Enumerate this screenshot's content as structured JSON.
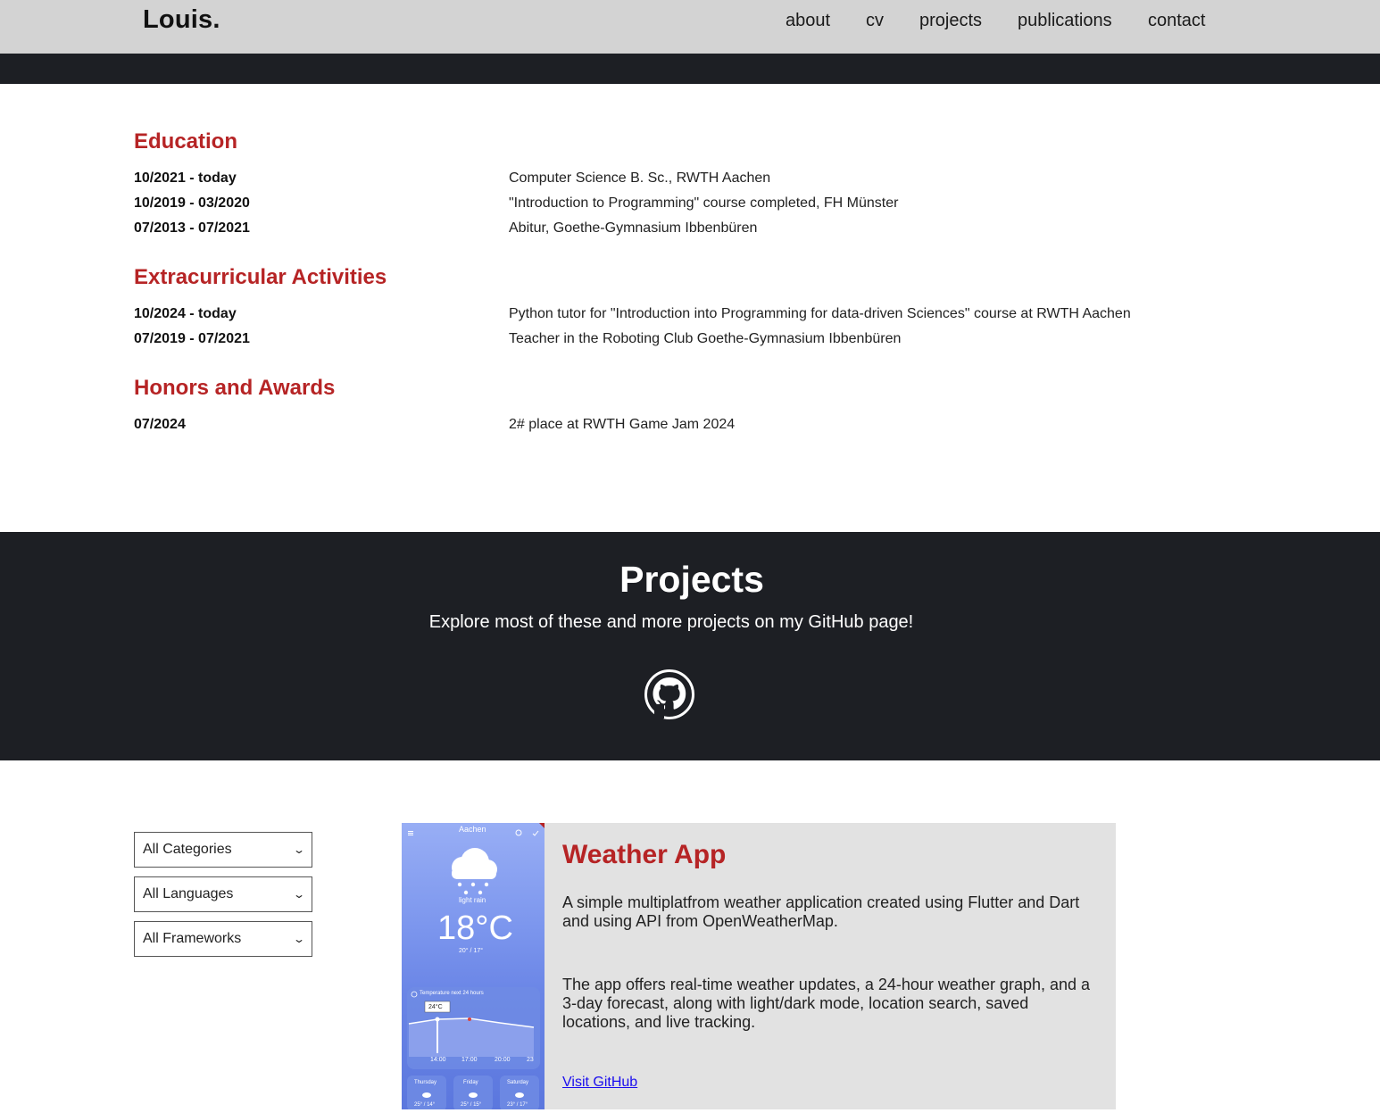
{
  "navbar": {
    "brand": "Louis.",
    "links": [
      "about",
      "cv",
      "projects",
      "publications",
      "contact"
    ]
  },
  "cv": {
    "education": {
      "heading": "Education",
      "entries": [
        {
          "date": "10/2021 - today",
          "text": "Computer Science B. Sc., RWTH Aachen"
        },
        {
          "date": "10/2019 - 03/2020",
          "text": "\"Introduction to Programming\" course completed, FH Münster"
        },
        {
          "date": "07/2013 - 07/2021",
          "text": "Abitur, Goethe-Gymnasium Ibbenbüren"
        }
      ]
    },
    "extracurricular": {
      "heading": "Extracurricular Activities",
      "entries": [
        {
          "date": "10/2024 - today",
          "text": "Python tutor for \"Introduction into Programming for data-driven Sciences\" course at RWTH Aachen"
        },
        {
          "date": "07/2019 - 07/2021",
          "text": "Teacher in the Roboting Club Goethe-Gymnasium Ibbenbüren"
        }
      ]
    },
    "honors": {
      "heading": "Honors and Awards",
      "entries": [
        {
          "date": "07/2024",
          "text": "2# place at RWTH Game Jam 2024"
        }
      ]
    }
  },
  "projects": {
    "title": "Projects",
    "subtitle": "Explore most of these and more projects on my GitHub page!",
    "icon": "github-icon",
    "filters": [
      "All Categories",
      "All Languages",
      "All Frameworks"
    ],
    "card": {
      "title": "Weather App",
      "p1": "A simple multiplatfrom weather application created using Flutter and Dart and using API from OpenWeatherMap.",
      "p2": "The app offers real-time weather updates, a 24-hour weather graph, and a 3-day forecast, along with light/dark mode, location search, saved locations, and live tracking.",
      "link": "Visit GitHub",
      "screenshot": {
        "city": "Aachen",
        "condition": "light rain",
        "temp": "18°C",
        "hi_lo": "20° / 17°",
        "graph_label": "Temperature next 24 hours",
        "graph_badge": "24°C",
        "graph_times": [
          "14:00",
          "17:00",
          "20:00",
          "23"
        ],
        "days": [
          {
            "name": "Thursday",
            "temps": "25° / 14°"
          },
          {
            "name": "Friday",
            "temps": "25° / 15°"
          },
          {
            "name": "Saturday",
            "temps": "23° / 17°"
          }
        ]
      }
    }
  },
  "colors": {
    "accent": "#b62425",
    "navbar_bg": "#d3d3d3",
    "dark_band": "#1d1f24",
    "card_bg": "#e2e2e2",
    "link": "#1a0dee"
  }
}
